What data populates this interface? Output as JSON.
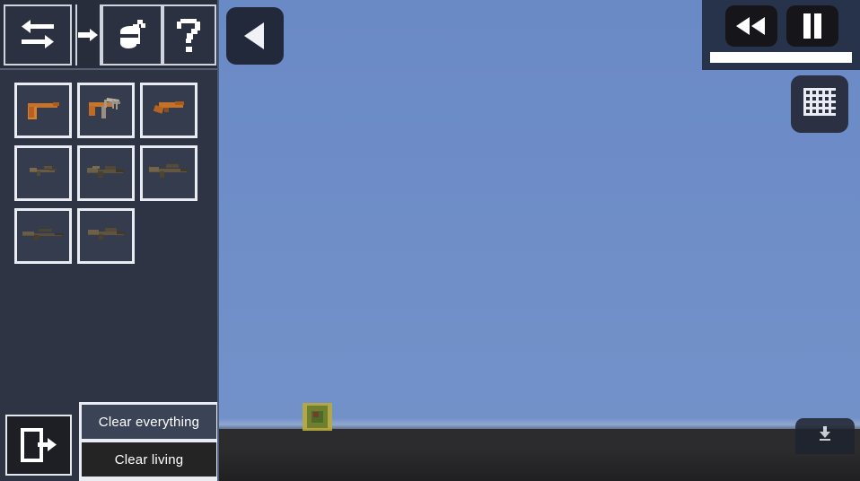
{
  "app": {
    "title": "Sandbox Weapon Simulator",
    "theme": {
      "sidebar_bg": "#2e3443",
      "toolbar_bg": "#272d3b",
      "slot_border": "#e9ecf2",
      "sky": "#6f8ec8",
      "ground": "#2c2c2e",
      "accent_white": "#ffffff",
      "clear_everything_bg": "#3b4456",
      "clear_living_bg": "#242424"
    }
  },
  "sidebar": {
    "toolbar": {
      "buttons": [
        {
          "id": "swap",
          "icon": "swap-arrows-icon",
          "label": "Swap"
        },
        {
          "id": "insert",
          "icon": "arrow-right-icon",
          "label": "Insert"
        },
        {
          "id": "spray",
          "icon": "spray-can-icon",
          "label": "Spray"
        },
        {
          "id": "help",
          "icon": "question-mark-icon",
          "label": "Help"
        }
      ]
    },
    "inventory": {
      "columns": 3,
      "slots": [
        {
          "index": 0,
          "name": "pistol",
          "icon": "pistol-icon",
          "selected": false
        },
        {
          "index": 1,
          "name": "machine-pistol",
          "icon": "smg-icon",
          "selected": false
        },
        {
          "index": 2,
          "name": "sawed-off-shotgun",
          "icon": "sawed-off-icon",
          "selected": false
        },
        {
          "index": 3,
          "name": "carbine",
          "icon": "carbine-icon",
          "selected": false
        },
        {
          "index": 4,
          "name": "assault-rifle",
          "icon": "assault-rifle-icon",
          "selected": false
        },
        {
          "index": 5,
          "name": "battle-rifle",
          "icon": "battle-rifle-icon",
          "selected": false
        },
        {
          "index": 6,
          "name": "sniper-rifle",
          "icon": "sniper-rifle-icon",
          "selected": false
        },
        {
          "index": 7,
          "name": "shotgun",
          "icon": "shotgun-icon",
          "selected": false
        }
      ]
    },
    "exit_button": {
      "icon": "exit-door-icon",
      "label": "Exit"
    },
    "clear_buttons": {
      "everything_label": "Clear everything",
      "living_label": "Clear living"
    }
  },
  "world_controls": {
    "collapse_button": {
      "icon": "triangle-left-icon",
      "label": "Collapse panel"
    },
    "playback": {
      "rewind": {
        "icon": "rewind-icon",
        "label": "Rewind"
      },
      "pause": {
        "icon": "pause-icon",
        "label": "Pause"
      },
      "speed_slider": {
        "value": 100,
        "min": 0,
        "max": 100
      }
    },
    "grid_button": {
      "icon": "grid-icon",
      "label": "Toggle grid"
    },
    "bottom_tab": {
      "icon": "download-icon",
      "label": "Spawn menu"
    }
  },
  "scene": {
    "crate": {
      "name": "crate-object"
    },
    "dropped_weapon": {
      "name": "dropped-weapon"
    }
  }
}
